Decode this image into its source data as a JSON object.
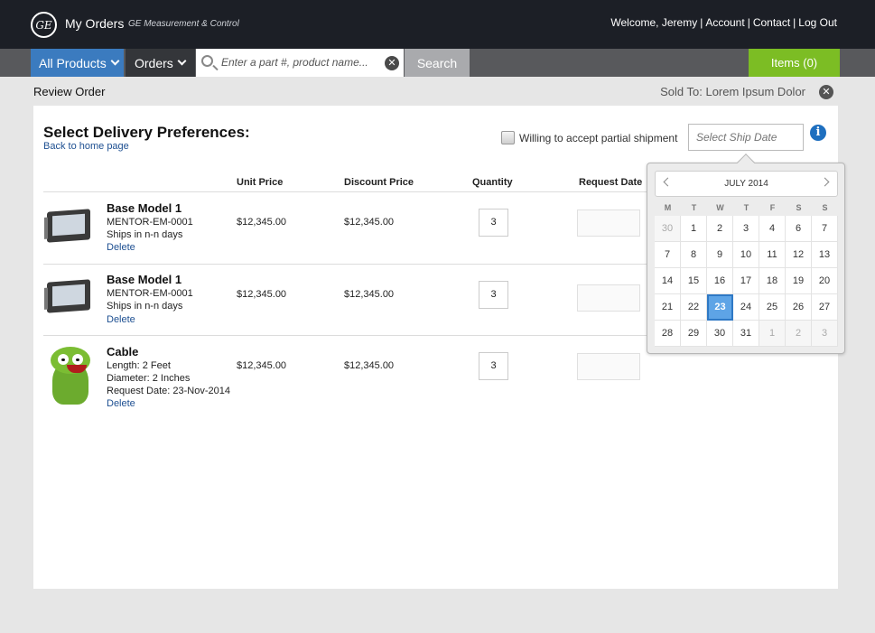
{
  "header": {
    "logo_text": "GE",
    "app_title": "My Orders",
    "app_subtitle": "GE Measurement & Control",
    "welcome": "Welcome, Jeremy",
    "links": [
      "Account",
      "Contact",
      "Log Out"
    ]
  },
  "nav": {
    "all_products": "All Products",
    "orders": "Orders",
    "search_placeholder": "Enter a part #, product name...",
    "search_button": "Search",
    "items": "Items (0)"
  },
  "review": {
    "title": "Review Order",
    "sold_to": "Sold To: Lorem Ipsum Dolor"
  },
  "panel": {
    "title": "Select Delivery Preferences:",
    "back_link": "Back to home page",
    "partial_label": "Willing to accept partial shipment",
    "ship_placeholder": "Select Ship Date",
    "columns": {
      "unit_price": "Unit Price",
      "discount_price": "Discount Price",
      "quantity": "Quantity",
      "request_date": "Request Date"
    }
  },
  "products": [
    {
      "name": "Base Model 1",
      "lines": [
        "MENTOR-EM-0001",
        "Ships in n-n days"
      ],
      "delete": "Delete",
      "unit_price": "$12,345.00",
      "discount_price": "$12,345.00",
      "quantity": "3"
    },
    {
      "name": "Base Model 1",
      "lines": [
        "MENTOR-EM-0001",
        "Ships in n-n days"
      ],
      "delete": "Delete",
      "unit_price": "$12,345.00",
      "discount_price": "$12,345.00",
      "quantity": "3"
    },
    {
      "name": "Cable",
      "lines": [
        "Length: 2 Feet",
        "Diameter: 2 Inches",
        "Request Date: 23-Nov-2014"
      ],
      "delete": "Delete",
      "unit_price": "$12,345.00",
      "discount_price": "$12,345.00",
      "quantity": "3"
    }
  ],
  "calendar": {
    "month": "JULY 2014",
    "weekdays": [
      "M",
      "T",
      "W",
      "T",
      "F",
      "S",
      "S"
    ],
    "weeks": [
      [
        "30",
        "1",
        "2",
        "3",
        "4",
        "6",
        "7"
      ],
      [
        "7",
        "8",
        "9",
        "10",
        "11",
        "12",
        "13"
      ],
      [
        "14",
        "15",
        "16",
        "17",
        "18",
        "19",
        "20"
      ],
      [
        "21",
        "22",
        "23",
        "24",
        "25",
        "26",
        "27"
      ],
      [
        "28",
        "29",
        "30",
        "31",
        "1",
        "2",
        "3"
      ]
    ],
    "selected": "23",
    "selected_color": "#5ea4e6"
  },
  "colors": {
    "topbar": "#1c1f26",
    "nav_active": "#3b7bbf",
    "items_button": "#7cbd24",
    "link": "#1d4f91"
  }
}
